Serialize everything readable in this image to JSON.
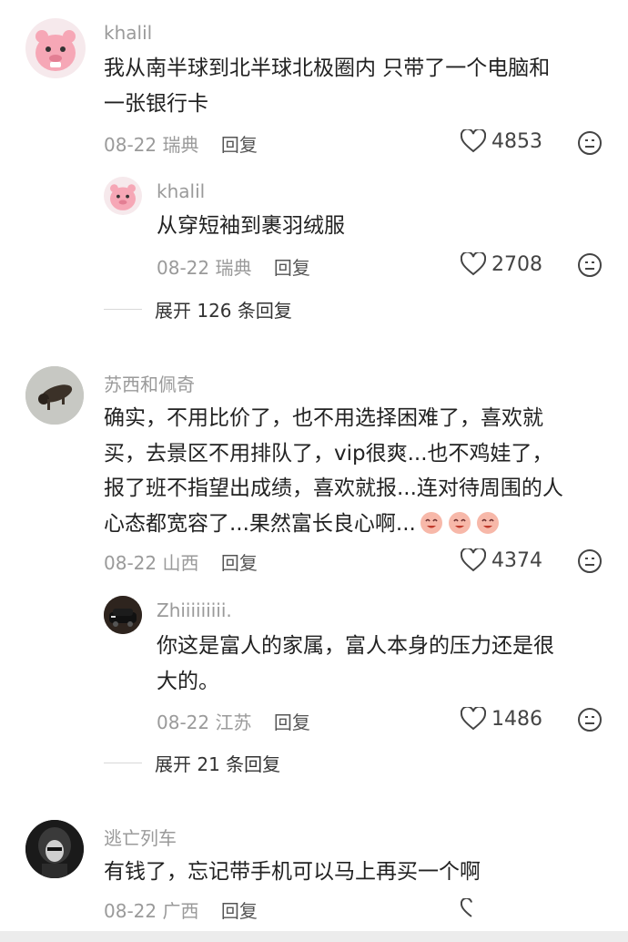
{
  "comments": [
    {
      "user": "khalil",
      "text": "我从南半球到北半球北极圈内 只带了一个电脑和\n一张银行卡",
      "date": "08-22",
      "location": "瑞典",
      "reply_label": "回复",
      "likes": "4853",
      "avatar_icon": "pink-pig-avatar",
      "replies": [
        {
          "user": "khalil",
          "text": "从穿短袖到裹羽绒服",
          "date": "08-22",
          "location": "瑞典",
          "reply_label": "回复",
          "likes": "2708",
          "avatar_icon": "pink-pig-avatar"
        }
      ],
      "expand_label": "展开 126 条回复"
    },
    {
      "user": "苏西和佩奇",
      "text": "确实，不用比价了，也不用选择困难了，喜欢就\n买，去景区不用排队了，vip很爽...也不鸡娃了，\n报了班不指望出成绩，喜欢就报...连对待周围的人\n心态都宽容了...果然富长良心啊...",
      "date": "08-22",
      "location": "山西",
      "reply_label": "回复",
      "likes": "4374",
      "avatar_icon": "dog-photo-avatar",
      "emoji_icon": "laughing-peach-emoji",
      "replies": [
        {
          "user": "Zhiiiiiiiii.",
          "text": "你这是富人的家属，富人本身的压力还是很\n大的。",
          "date": "08-22",
          "location": "江苏",
          "reply_label": "回复",
          "likes": "1486",
          "avatar_icon": "car-photo-avatar"
        }
      ],
      "expand_label": "展开 21 条回复"
    },
    {
      "user": "逃亡列车",
      "text": "有钱了，忘记带手机可以马上再买一个啊",
      "date": "08-22",
      "location": "广西",
      "reply_label": "回复",
      "avatar_icon": "person-photo-avatar"
    }
  ],
  "colors": {
    "muted": "#9a9a9a",
    "text": "#222222",
    "divider": "#d8d8d8"
  }
}
